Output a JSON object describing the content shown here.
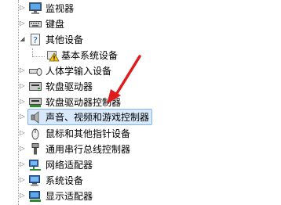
{
  "device_tree": {
    "items": [
      {
        "label": "监视器",
        "icon": "monitor-icon",
        "glyph": "▷",
        "state": "collapsed"
      },
      {
        "label": "键盘",
        "icon": "keyboard-icon",
        "glyph": "▷",
        "state": "collapsed"
      },
      {
        "label": "其他设备",
        "icon": "unknown-device-icon",
        "glyph": "◢",
        "state": "expanded"
      },
      {
        "label": "基本系统设备",
        "icon": "warning-device-icon",
        "state": "child"
      },
      {
        "label": "人体学输入设备",
        "icon": "hid-icon",
        "glyph": "▷",
        "state": "collapsed"
      },
      {
        "label": "软盘驱动器",
        "icon": "floppy-drive-icon",
        "glyph": "▷",
        "state": "collapsed"
      },
      {
        "label": "软盘驱动器控制器",
        "icon": "floppy-controller-icon",
        "glyph": "▷",
        "state": "collapsed"
      },
      {
        "label": "声音、视频和游戏控制器",
        "icon": "speaker-icon",
        "glyph": "▷",
        "state": "selected"
      },
      {
        "label": "鼠标和其他指针设备",
        "icon": "mouse-icon",
        "glyph": "▷",
        "state": "collapsed"
      },
      {
        "label": "通用串行总线控制器",
        "icon": "usb-icon",
        "glyph": "▷",
        "state": "collapsed"
      },
      {
        "label": "网络适配器",
        "icon": "network-adapter-icon",
        "glyph": "▷",
        "state": "collapsed"
      },
      {
        "label": "系统设备",
        "icon": "system-device-icon",
        "glyph": "▷",
        "state": "collapsed"
      },
      {
        "label": "显示适配器",
        "icon": "display-adapter-icon",
        "glyph": "▷",
        "state": "collapsed"
      }
    ]
  },
  "colors": {
    "selection_fill": "#d7e9fb",
    "selection_border": "#7fb4ec",
    "annotation_arrow": "#e01b1b"
  }
}
